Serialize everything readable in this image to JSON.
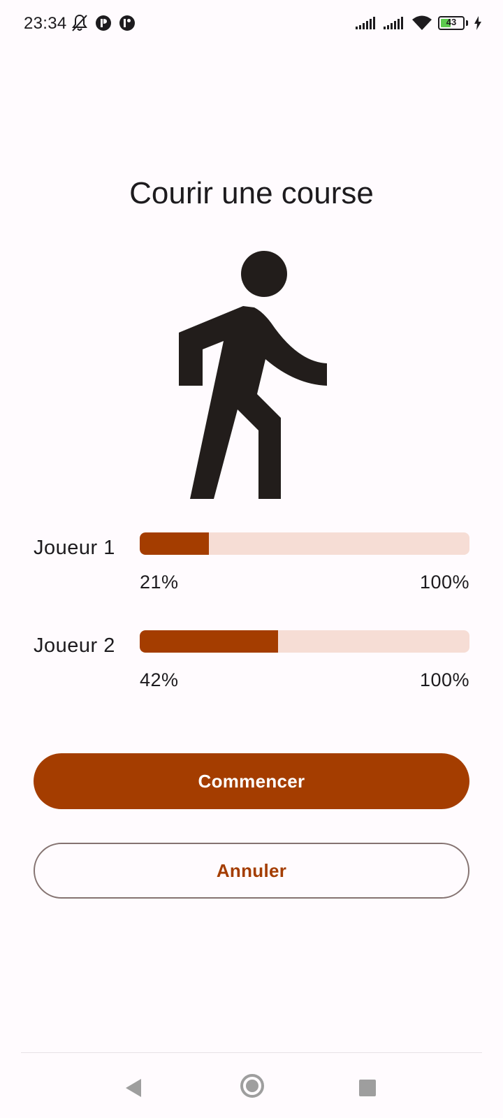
{
  "status_bar": {
    "time": "23:34",
    "battery_level": "43",
    "icons": [
      "bell-off-icon",
      "app-notification-icon",
      "app-notification-icon",
      "signal-icon",
      "signal-icon",
      "wifi-icon",
      "battery-icon",
      "charging-icon"
    ]
  },
  "main": {
    "title": "Courir une course",
    "illustration": "directions-walk-icon"
  },
  "players": [
    {
      "label": "Joueur 1",
      "progress": 0.21,
      "min_label": "21%",
      "max_label": "100%"
    },
    {
      "label": "Joueur 2",
      "progress": 0.42,
      "min_label": "42%",
      "max_label": "100%"
    }
  ],
  "buttons": {
    "start_label": "Commencer",
    "cancel_label": "Annuler"
  },
  "colors": {
    "accent": "#a43d00",
    "track": "#f6ddd5",
    "background": "#fffbfe"
  },
  "nav_bar": {
    "icons": [
      "back-icon",
      "home-icon",
      "recents-icon"
    ]
  }
}
